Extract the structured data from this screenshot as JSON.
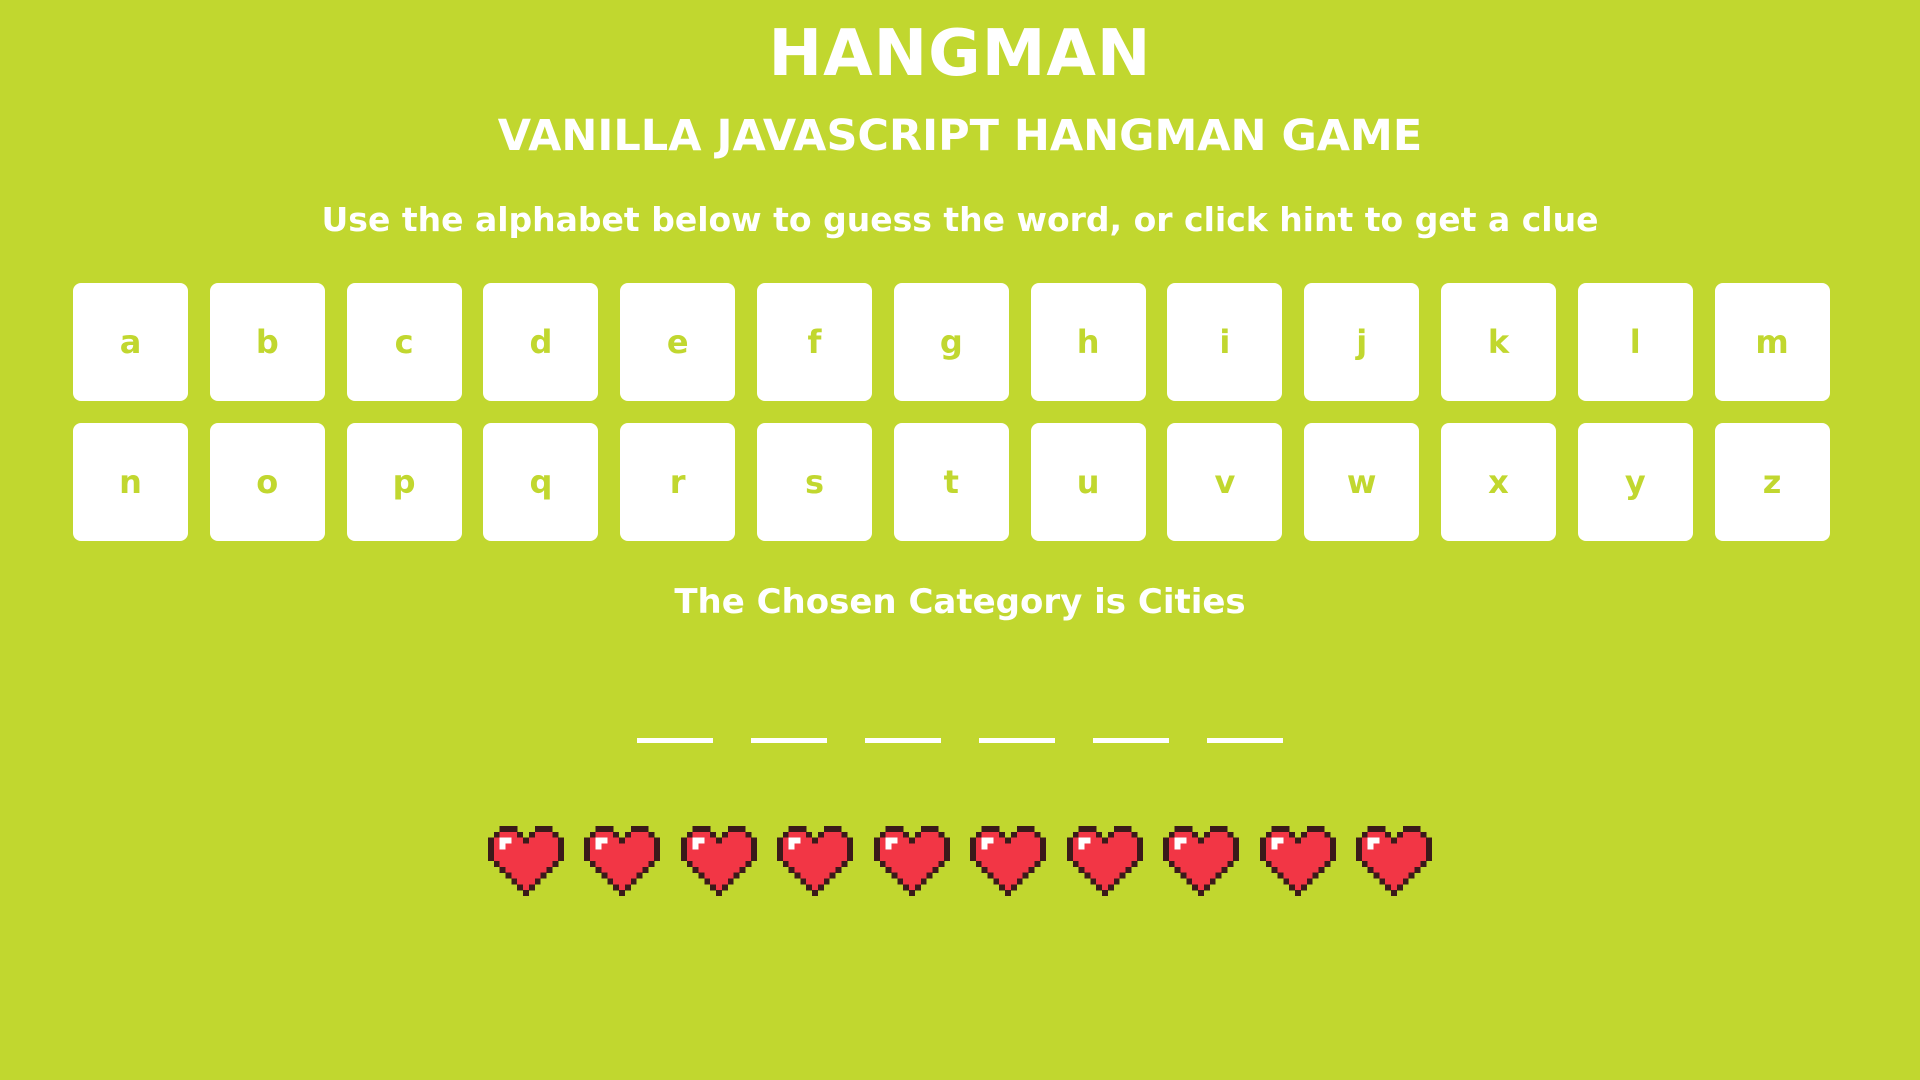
{
  "header": {
    "title": "HANGMAN",
    "subtitle": "VANILLA JAVASCRIPT HANGMAN GAME",
    "instructions": "Use the alphabet below to guess the word, or click hint to get a clue"
  },
  "keyboard": {
    "letters": [
      "a",
      "b",
      "c",
      "d",
      "e",
      "f",
      "g",
      "h",
      "i",
      "j",
      "k",
      "l",
      "m",
      "n",
      "o",
      "p",
      "q",
      "r",
      "s",
      "t",
      "u",
      "v",
      "w",
      "x",
      "y",
      "z"
    ]
  },
  "game": {
    "category_text": "The Chosen Category is Cities",
    "word_length": 6,
    "lives_remaining": 10,
    "life_icon": "pixel-heart-icon"
  },
  "colors": {
    "background": "#c1d72f",
    "key_background": "#ffffff",
    "key_text": "#c1d72f",
    "heart_fill": "#f23645",
    "heart_outline": "#3a1a1a",
    "heart_highlight": "#ffffff"
  }
}
